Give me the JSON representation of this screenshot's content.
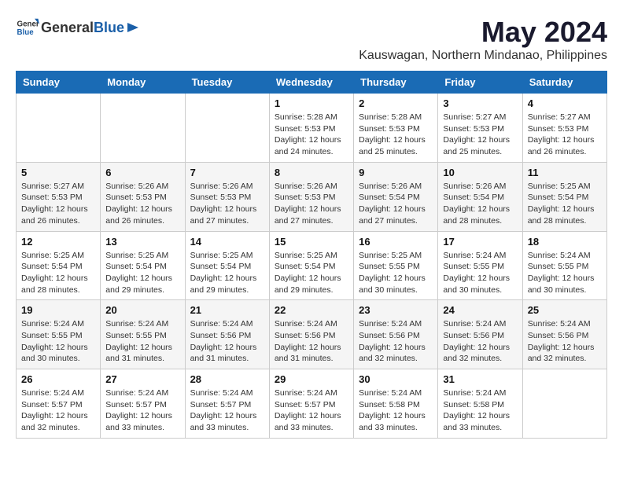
{
  "header": {
    "logo": {
      "text_general": "General",
      "text_blue": "Blue"
    },
    "title": "May 2024",
    "location": "Kauswagan, Northern Mindanao, Philippines"
  },
  "weekdays": [
    "Sunday",
    "Monday",
    "Tuesday",
    "Wednesday",
    "Thursday",
    "Friday",
    "Saturday"
  ],
  "weeks": [
    [
      {
        "day": "",
        "sunrise": "",
        "sunset": "",
        "daylight": ""
      },
      {
        "day": "",
        "sunrise": "",
        "sunset": "",
        "daylight": ""
      },
      {
        "day": "",
        "sunrise": "",
        "sunset": "",
        "daylight": ""
      },
      {
        "day": "1",
        "sunrise": "5:28 AM",
        "sunset": "5:53 PM",
        "daylight": "12 hours and 24 minutes."
      },
      {
        "day": "2",
        "sunrise": "5:28 AM",
        "sunset": "5:53 PM",
        "daylight": "12 hours and 25 minutes."
      },
      {
        "day": "3",
        "sunrise": "5:27 AM",
        "sunset": "5:53 PM",
        "daylight": "12 hours and 25 minutes."
      },
      {
        "day": "4",
        "sunrise": "5:27 AM",
        "sunset": "5:53 PM",
        "daylight": "12 hours and 26 minutes."
      }
    ],
    [
      {
        "day": "5",
        "sunrise": "5:27 AM",
        "sunset": "5:53 PM",
        "daylight": "12 hours and 26 minutes."
      },
      {
        "day": "6",
        "sunrise": "5:26 AM",
        "sunset": "5:53 PM",
        "daylight": "12 hours and 26 minutes."
      },
      {
        "day": "7",
        "sunrise": "5:26 AM",
        "sunset": "5:53 PM",
        "daylight": "12 hours and 27 minutes."
      },
      {
        "day": "8",
        "sunrise": "5:26 AM",
        "sunset": "5:53 PM",
        "daylight": "12 hours and 27 minutes."
      },
      {
        "day": "9",
        "sunrise": "5:26 AM",
        "sunset": "5:54 PM",
        "daylight": "12 hours and 27 minutes."
      },
      {
        "day": "10",
        "sunrise": "5:26 AM",
        "sunset": "5:54 PM",
        "daylight": "12 hours and 28 minutes."
      },
      {
        "day": "11",
        "sunrise": "5:25 AM",
        "sunset": "5:54 PM",
        "daylight": "12 hours and 28 minutes."
      }
    ],
    [
      {
        "day": "12",
        "sunrise": "5:25 AM",
        "sunset": "5:54 PM",
        "daylight": "12 hours and 28 minutes."
      },
      {
        "day": "13",
        "sunrise": "5:25 AM",
        "sunset": "5:54 PM",
        "daylight": "12 hours and 29 minutes."
      },
      {
        "day": "14",
        "sunrise": "5:25 AM",
        "sunset": "5:54 PM",
        "daylight": "12 hours and 29 minutes."
      },
      {
        "day": "15",
        "sunrise": "5:25 AM",
        "sunset": "5:54 PM",
        "daylight": "12 hours and 29 minutes."
      },
      {
        "day": "16",
        "sunrise": "5:25 AM",
        "sunset": "5:55 PM",
        "daylight": "12 hours and 30 minutes."
      },
      {
        "day": "17",
        "sunrise": "5:24 AM",
        "sunset": "5:55 PM",
        "daylight": "12 hours and 30 minutes."
      },
      {
        "day": "18",
        "sunrise": "5:24 AM",
        "sunset": "5:55 PM",
        "daylight": "12 hours and 30 minutes."
      }
    ],
    [
      {
        "day": "19",
        "sunrise": "5:24 AM",
        "sunset": "5:55 PM",
        "daylight": "12 hours and 30 minutes."
      },
      {
        "day": "20",
        "sunrise": "5:24 AM",
        "sunset": "5:55 PM",
        "daylight": "12 hours and 31 minutes."
      },
      {
        "day": "21",
        "sunrise": "5:24 AM",
        "sunset": "5:56 PM",
        "daylight": "12 hours and 31 minutes."
      },
      {
        "day": "22",
        "sunrise": "5:24 AM",
        "sunset": "5:56 PM",
        "daylight": "12 hours and 31 minutes."
      },
      {
        "day": "23",
        "sunrise": "5:24 AM",
        "sunset": "5:56 PM",
        "daylight": "12 hours and 32 minutes."
      },
      {
        "day": "24",
        "sunrise": "5:24 AM",
        "sunset": "5:56 PM",
        "daylight": "12 hours and 32 minutes."
      },
      {
        "day": "25",
        "sunrise": "5:24 AM",
        "sunset": "5:56 PM",
        "daylight": "12 hours and 32 minutes."
      }
    ],
    [
      {
        "day": "26",
        "sunrise": "5:24 AM",
        "sunset": "5:57 PM",
        "daylight": "12 hours and 32 minutes."
      },
      {
        "day": "27",
        "sunrise": "5:24 AM",
        "sunset": "5:57 PM",
        "daylight": "12 hours and 33 minutes."
      },
      {
        "day": "28",
        "sunrise": "5:24 AM",
        "sunset": "5:57 PM",
        "daylight": "12 hours and 33 minutes."
      },
      {
        "day": "29",
        "sunrise": "5:24 AM",
        "sunset": "5:57 PM",
        "daylight": "12 hours and 33 minutes."
      },
      {
        "day": "30",
        "sunrise": "5:24 AM",
        "sunset": "5:58 PM",
        "daylight": "12 hours and 33 minutes."
      },
      {
        "day": "31",
        "sunrise": "5:24 AM",
        "sunset": "5:58 PM",
        "daylight": "12 hours and 33 minutes."
      },
      {
        "day": "",
        "sunrise": "",
        "sunset": "",
        "daylight": ""
      }
    ]
  ]
}
